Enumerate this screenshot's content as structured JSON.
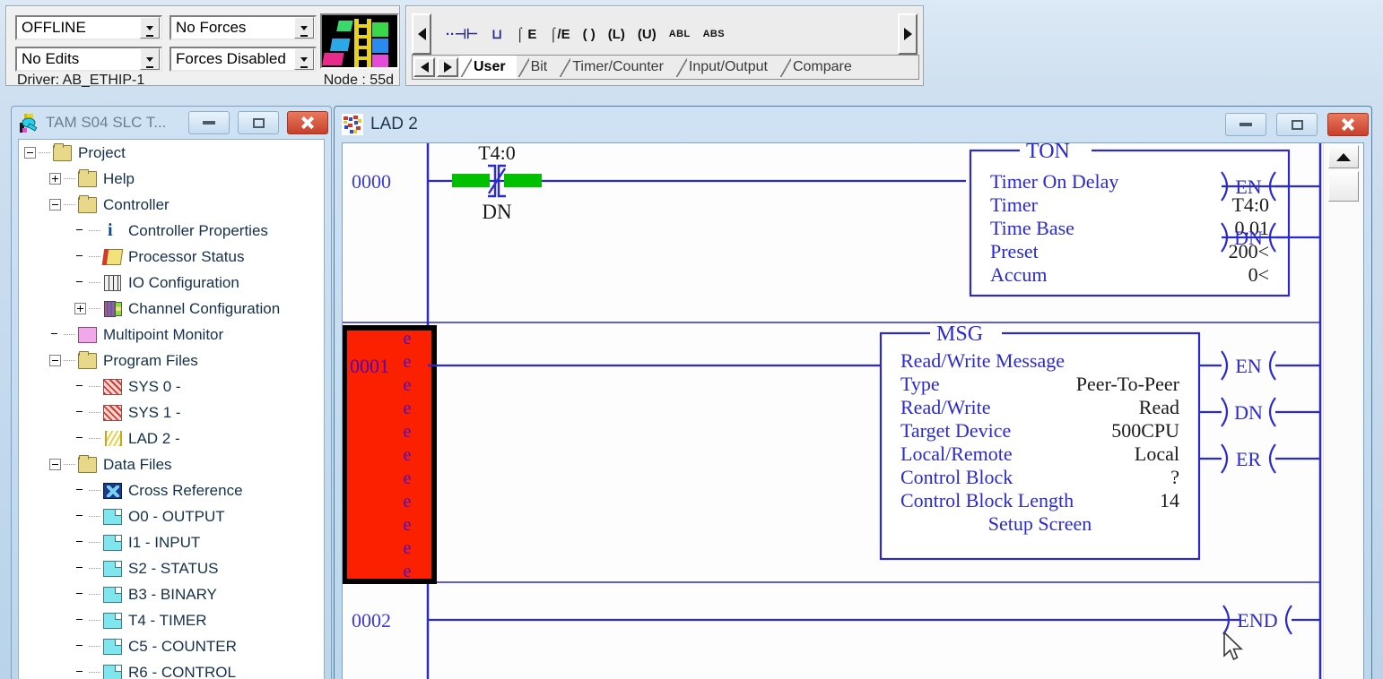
{
  "status_bar": {
    "mode_value": "OFFLINE",
    "edits_value": "No Edits",
    "forces_value": "No Forces",
    "forces_state_value": "Forces Disabled",
    "driver_text": "Driver: AB_ETHIP-1",
    "node_text": "Node : 55d",
    "thumbnail_icon": "ladder-thumbnail-icon"
  },
  "instruction_toolbar": {
    "scroll_left_icon": "scroll-left-arrow-icon",
    "scroll_right_icon": "scroll-right-arrow-icon",
    "icons": [
      {
        "name": "branch-icon",
        "glyph": "··⊣⊢",
        "style": "accent"
      },
      {
        "name": "branch-open-icon",
        "glyph": "⊔",
        "style": "accent"
      },
      {
        "name": "xic-examine-on-icon",
        "glyph": "⌠ E",
        "style": "dark"
      },
      {
        "name": "xio-examine-off-icon",
        "glyph": "⌠/E",
        "style": "dark"
      },
      {
        "name": "ote-output-energize-icon",
        "glyph": "( )",
        "style": "dark"
      },
      {
        "name": "otl-output-latch-icon",
        "glyph": "(L)",
        "style": "dark"
      },
      {
        "name": "otu-output-unlatch-icon",
        "glyph": "(U)",
        "style": "dark"
      },
      {
        "name": "abl-instruction-icon",
        "glyph": "ABL",
        "style": "small"
      },
      {
        "name": "abs-instruction-icon",
        "glyph": "ABS",
        "style": "small"
      }
    ],
    "tabs": [
      {
        "label": "User",
        "active": true
      },
      {
        "label": "Bit",
        "active": false
      },
      {
        "label": "Timer/Counter",
        "active": false
      },
      {
        "label": "Input/Output",
        "active": false
      },
      {
        "label": "Compare",
        "active": false
      }
    ],
    "tab_prev_icon": "tab-prev-arrow-icon",
    "tab_next_icon": "tab-next-arrow-icon"
  },
  "project_window": {
    "title": "TAM S04 SLC T...",
    "icon": "project-tree-icon",
    "minimize_icon": "minimize-icon",
    "maximize_icon": "maximize-icon",
    "close_icon": "close-icon",
    "tree": [
      {
        "label": "Project",
        "indent": 0,
        "toggle": "minus",
        "icon": "folder"
      },
      {
        "label": "Help",
        "indent": 1,
        "toggle": "plus",
        "icon": "folder"
      },
      {
        "label": "Controller",
        "indent": 1,
        "toggle": "minus",
        "icon": "folder"
      },
      {
        "label": "Controller Properties",
        "indent": 2,
        "toggle": "none",
        "icon": "info"
      },
      {
        "label": "Processor Status",
        "indent": 2,
        "toggle": "none",
        "icon": "pstat"
      },
      {
        "label": "IO Configuration",
        "indent": 2,
        "toggle": "none",
        "icon": "io"
      },
      {
        "label": "Channel Configuration",
        "indent": 2,
        "toggle": "plus",
        "icon": "chan"
      },
      {
        "label": "Multipoint Monitor",
        "indent": 1,
        "toggle": "none",
        "icon": "multi"
      },
      {
        "label": "Program Files",
        "indent": 1,
        "toggle": "minus",
        "icon": "folder"
      },
      {
        "label": "SYS 0 -",
        "indent": 2,
        "toggle": "none",
        "icon": "sys"
      },
      {
        "label": "SYS 1 -",
        "indent": 2,
        "toggle": "none",
        "icon": "sys"
      },
      {
        "label": "LAD 2 -",
        "indent": 2,
        "toggle": "none",
        "icon": "lad"
      },
      {
        "label": "Data Files",
        "indent": 1,
        "toggle": "minus",
        "icon": "folder"
      },
      {
        "label": "Cross Reference",
        "indent": 2,
        "toggle": "none",
        "icon": "xref"
      },
      {
        "label": "O0 - OUTPUT",
        "indent": 2,
        "toggle": "none",
        "icon": "data"
      },
      {
        "label": "I1 - INPUT",
        "indent": 2,
        "toggle": "none",
        "icon": "data"
      },
      {
        "label": "S2 - STATUS",
        "indent": 2,
        "toggle": "none",
        "icon": "data"
      },
      {
        "label": "B3 - BINARY",
        "indent": 2,
        "toggle": "none",
        "icon": "data"
      },
      {
        "label": "T4 - TIMER",
        "indent": 2,
        "toggle": "none",
        "icon": "data"
      },
      {
        "label": "C5 - COUNTER",
        "indent": 2,
        "toggle": "none",
        "icon": "data"
      },
      {
        "label": "R6 - CONTROL",
        "indent": 2,
        "toggle": "none",
        "icon": "data"
      }
    ]
  },
  "ladder_window": {
    "title": "LAD 2",
    "icon": "ladder-file-icon",
    "minimize_icon": "minimize-icon",
    "maximize_icon": "maximize-icon",
    "close_icon": "close-icon",
    "scroll_up_icon": "scroll-up-arrow-icon",
    "rungs": [
      {
        "number": "0000",
        "selected": false,
        "contact": {
          "type": "xio",
          "tag": "T4:0",
          "bit_label": "DN",
          "highlight_color": "#00c000"
        },
        "block": {
          "kind": "TON",
          "title": "TON",
          "description": "Timer On Delay",
          "fields": [
            {
              "label": "Timer",
              "value": "T4:0"
            },
            {
              "label": "Time Base",
              "value": "0.01"
            },
            {
              "label": "Preset",
              "value": "200<"
            },
            {
              "label": "Accum",
              "value": "0<"
            }
          ],
          "outputs": [
            "EN",
            "DN"
          ]
        }
      },
      {
        "number": "0001",
        "selected": true,
        "error_marker": "e",
        "error_marker_count": 11,
        "block": {
          "kind": "MSG",
          "title": "MSG",
          "description": "Read/Write Message",
          "fields": [
            {
              "label": "Type",
              "value": "Peer-To-Peer"
            },
            {
              "label": "Read/Write",
              "value": "Read"
            },
            {
              "label": "Target Device",
              "value": "500CPU"
            },
            {
              "label": "Local/Remote",
              "value": "Local"
            },
            {
              "label": "Control Block",
              "value": "?"
            },
            {
              "label": "Control Block Length",
              "value": "14"
            }
          ],
          "link_label": "Setup Screen",
          "outputs": [
            "EN",
            "DN",
            "ER"
          ]
        }
      },
      {
        "number": "0002",
        "selected": false,
        "end_label": "END"
      }
    ]
  },
  "colors": {
    "ladder_blue": "#2a2ad0",
    "rung_number": "#3a3ad8",
    "selection_red": "#fa2000",
    "contact_highlight": "#00c800",
    "value_black": "#1a1a1a",
    "title_bar": "#cfe2f3"
  },
  "cursor": {
    "icon": "mouse-pointer-icon"
  }
}
